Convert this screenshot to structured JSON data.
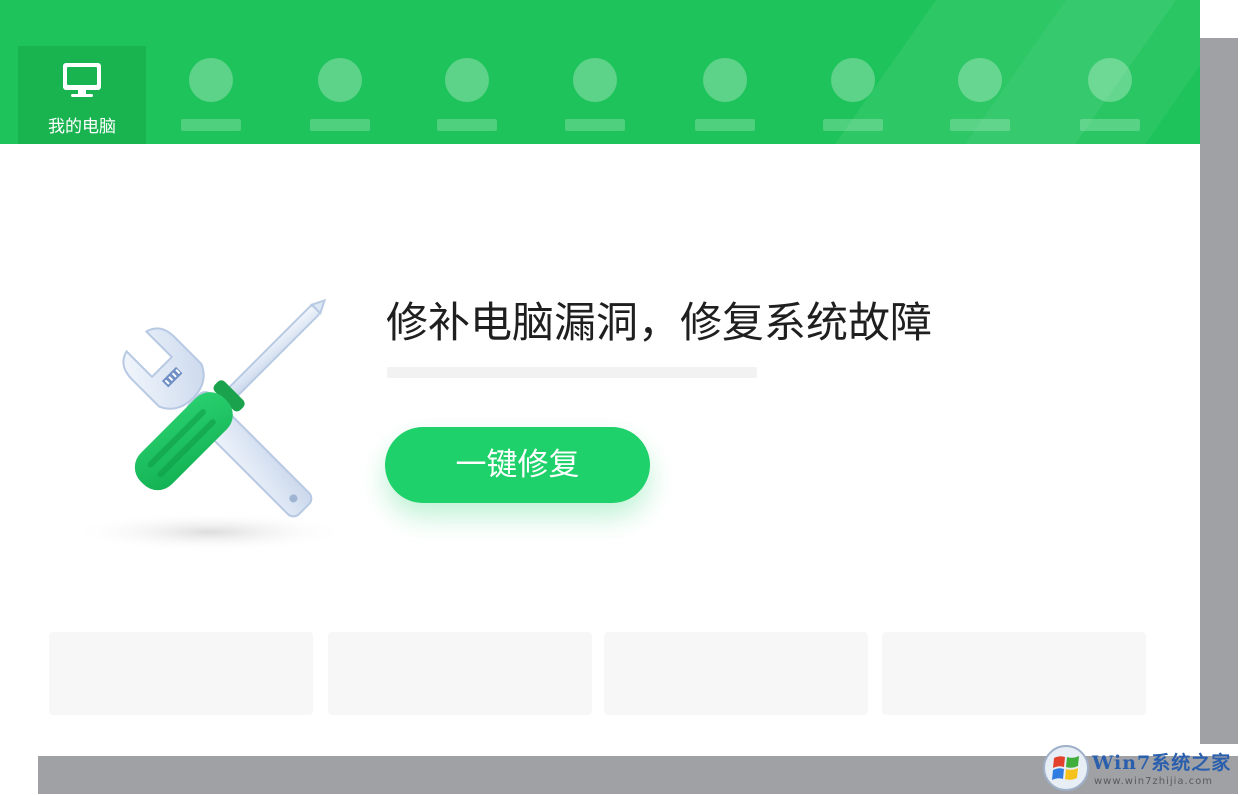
{
  "nav": {
    "tabs": [
      {
        "label": "我的电脑",
        "icon": "monitor-icon",
        "active": true
      },
      {
        "label": "",
        "icon": "placeholder-icon"
      },
      {
        "label": "",
        "icon": "placeholder-icon"
      },
      {
        "label": "",
        "icon": "placeholder-icon"
      },
      {
        "label": "",
        "icon": "placeholder-icon"
      },
      {
        "label": "",
        "icon": "placeholder-icon"
      },
      {
        "label": "",
        "icon": "placeholder-icon"
      },
      {
        "label": "",
        "icon": "placeholder-icon"
      },
      {
        "label": "",
        "icon": "placeholder-icon"
      }
    ]
  },
  "main": {
    "headline": "修补电脑漏洞，修复系统故障",
    "repair_button": "一键修复",
    "illustration_icon": "wrench-screwdriver-icon"
  },
  "watermark": {
    "text": "Win7系统之家",
    "sub": "www.win7zhijia.com"
  },
  "colors": {
    "header": "#1ec35b",
    "active_tab": "#19b350",
    "button": "#1fd16a",
    "shadow": "#9fa1a4"
  }
}
